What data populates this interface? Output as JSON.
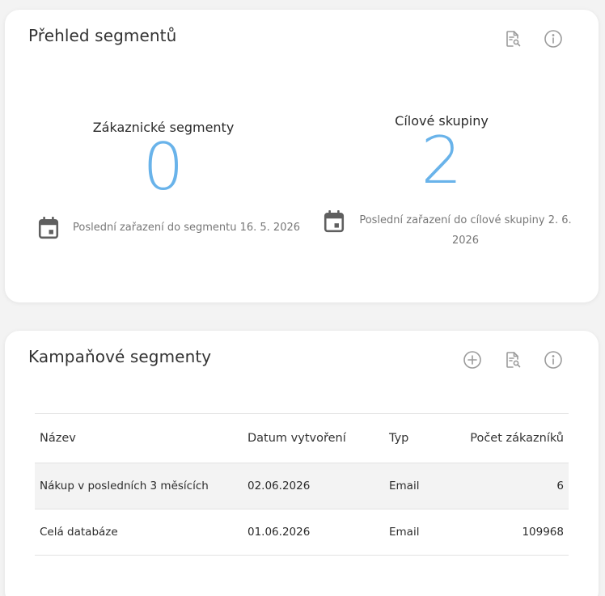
{
  "overview": {
    "title": "Přehled segmentů",
    "icons": [
      "report-search-icon",
      "info-icon"
    ],
    "customer_segments": {
      "label": "Zákaznické segmenty",
      "value": "0",
      "last_assignment": "Poslední zařazení do segmentu 16. 5. 2026"
    },
    "target_groups": {
      "label": "Cílové skupiny",
      "value": "2",
      "last_assignment": "Poslední zařazení do cílové skupiny 2. 6. 2026"
    }
  },
  "campaign": {
    "title": "Kampaňové segmenty",
    "icons": [
      "add-circle-icon",
      "report-search-icon",
      "info-icon"
    ],
    "columns": [
      "Název",
      "Datum vytvoření",
      "Typ",
      "Počet zákazníků"
    ],
    "rows": [
      [
        "Nákup v posledních 3 měsících",
        "02.06.2026",
        "Email",
        "6"
      ],
      [
        "Celá databáze",
        "01.06.2026",
        "Email",
        "109968"
      ]
    ]
  },
  "colors": {
    "accent": "#69b3ea",
    "icon": "#9b9b9b",
    "calendar_icon": "#5f5f5f",
    "row_shade": "#f3f3f3"
  }
}
